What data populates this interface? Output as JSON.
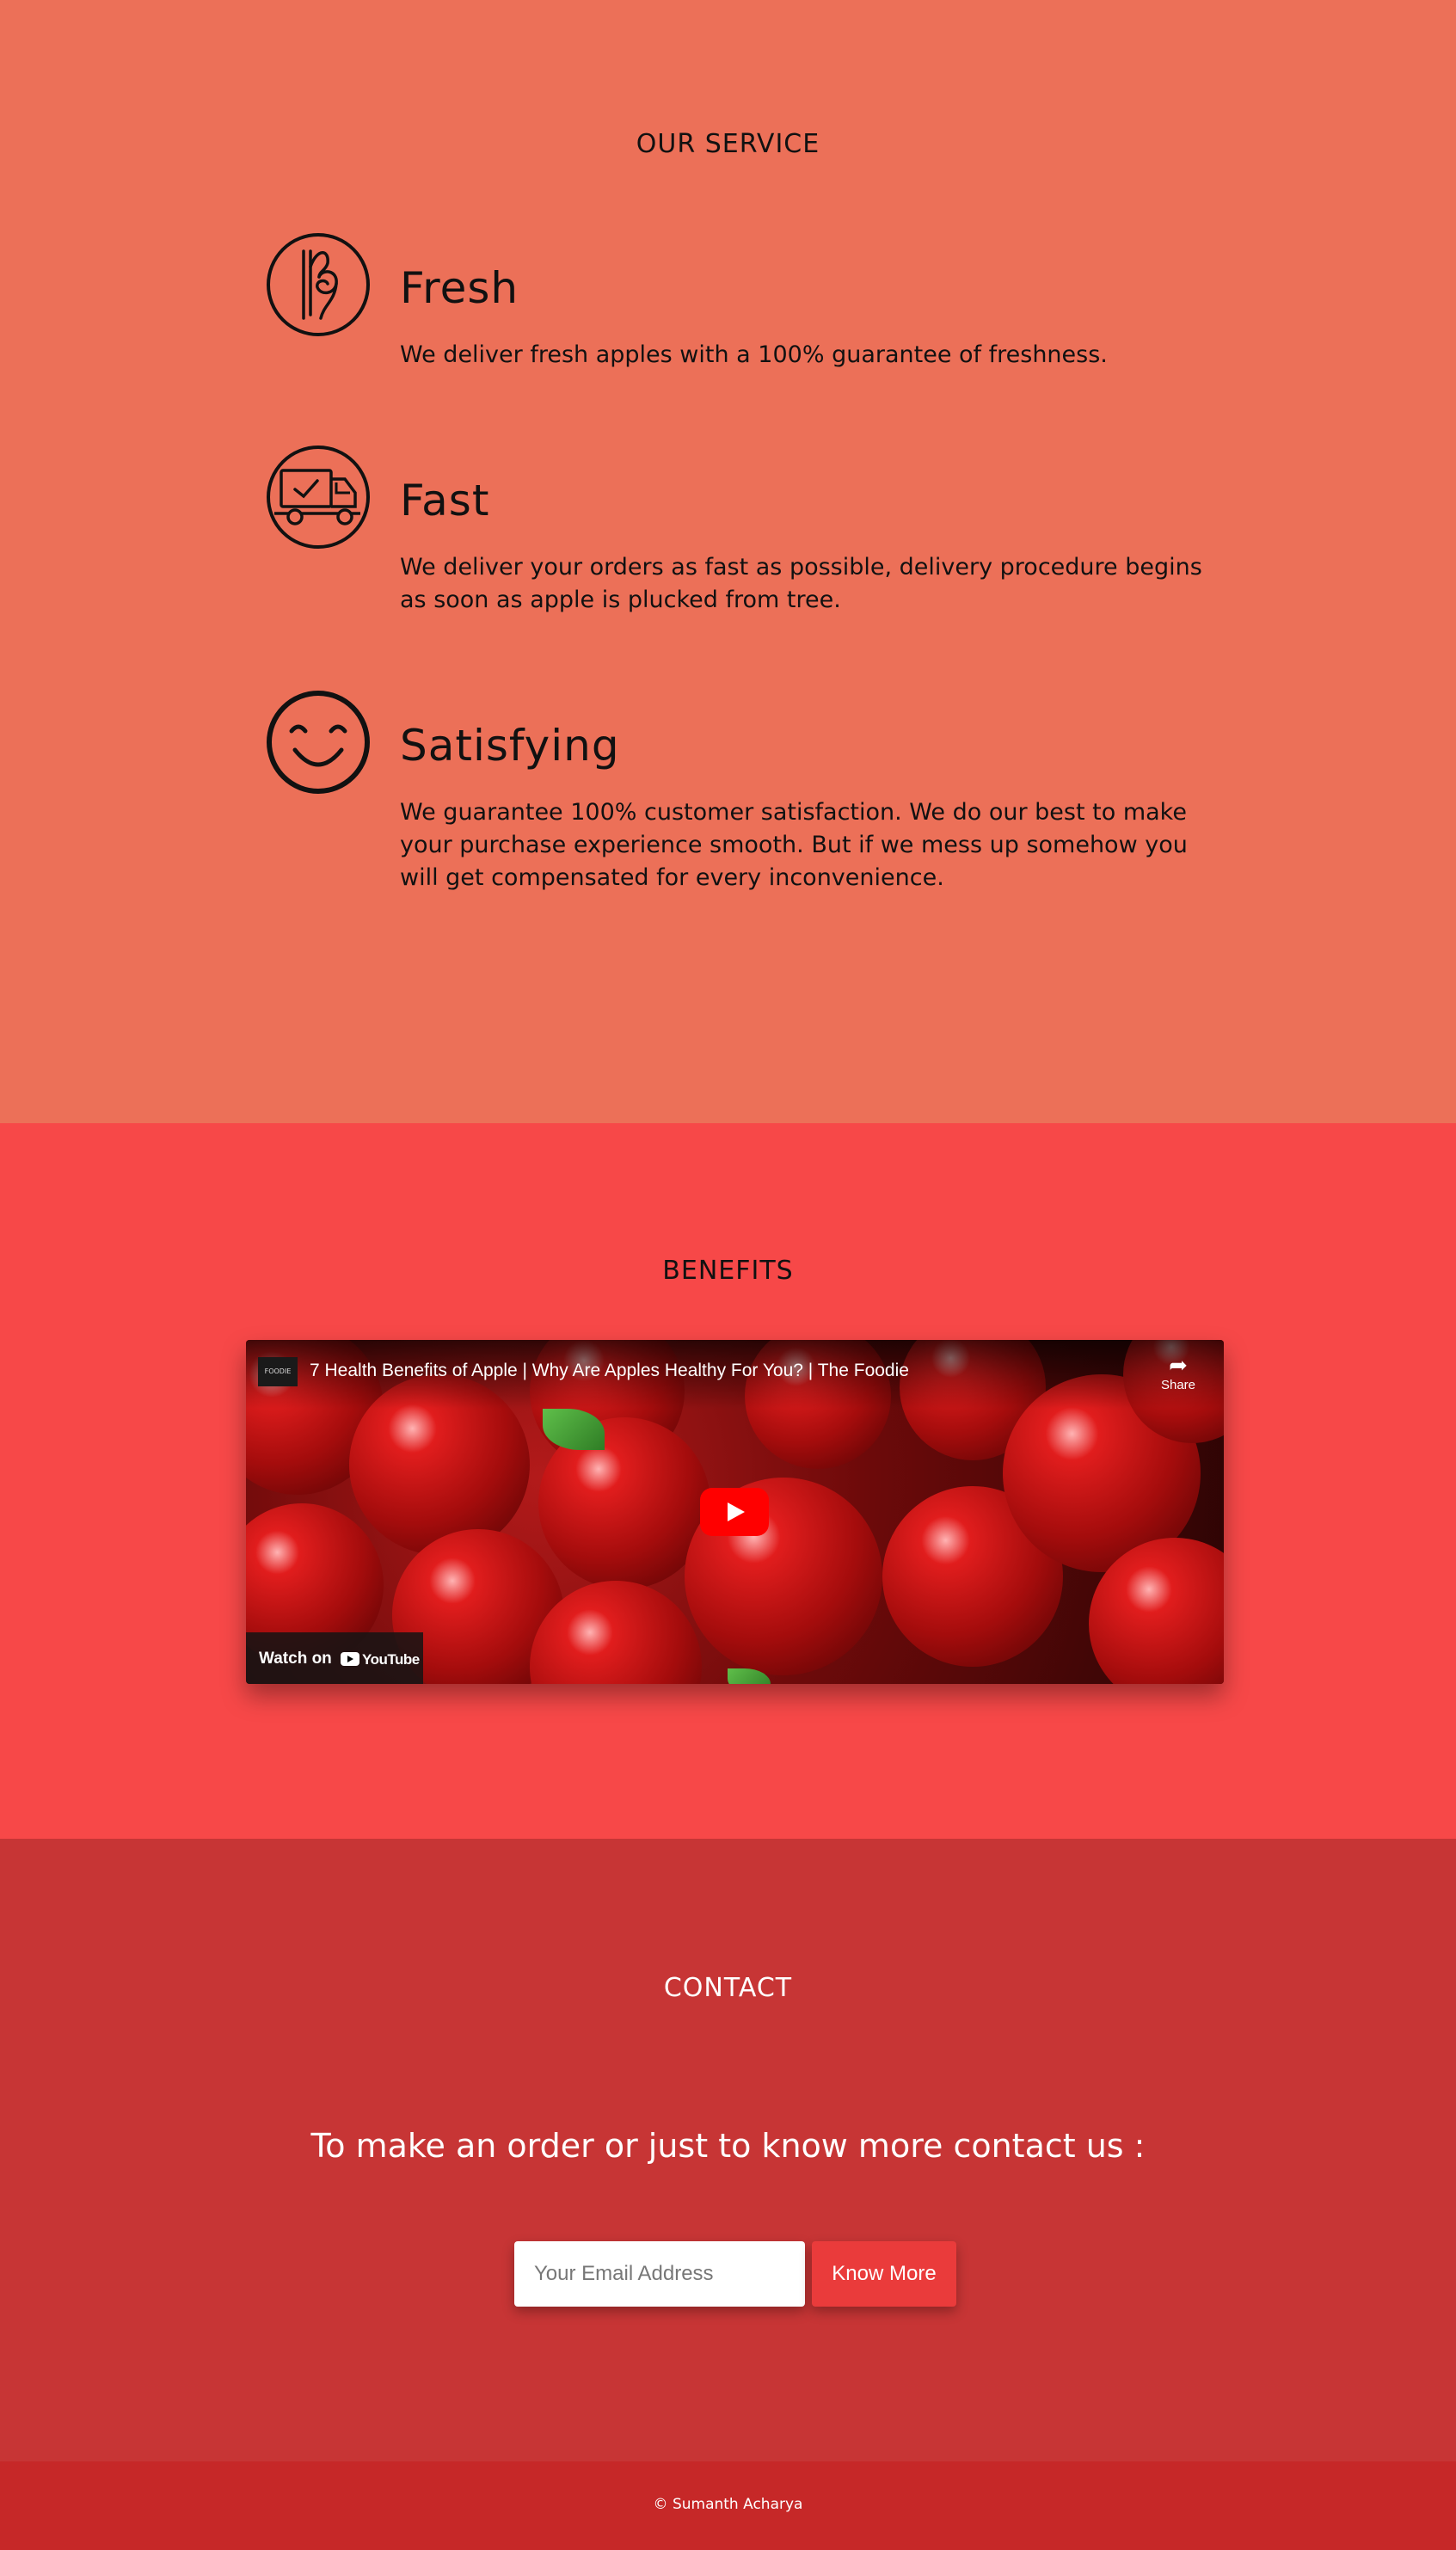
{
  "service": {
    "title": "OUR SERVICE",
    "features": [
      {
        "icon": "ok-hand-icon",
        "heading": "Fresh",
        "text": "We deliver fresh apples with a 100% guarantee of freshness."
      },
      {
        "icon": "delivery-truck-icon",
        "heading": "Fast",
        "text": "We deliver your orders as fast as possible, delivery procedure begins as soon as apple is plucked from tree."
      },
      {
        "icon": "smiley-face-icon",
        "heading": "Satisfying",
        "text": "We guarantee 100% customer satisfaction. We do our best to make your purchase experience smooth. But if we mess up somehow you will get compensated for every inconvenience."
      }
    ]
  },
  "benefits": {
    "title": "BENEFITS",
    "video": {
      "channel": "FOODIE",
      "title": "7 Health Benefits of Apple | Why Are Apples Healthy For You? | The Foodie",
      "share_label": "Share",
      "watch_on_label": "Watch on",
      "platform_label": "YouTube"
    }
  },
  "contact": {
    "title": "CONTACT",
    "text": "To make an order or just to know more contact us :",
    "email_placeholder": "Your Email Address",
    "button_label": "Know More"
  },
  "footer": {
    "copyright": "© Sumanth Acharya"
  },
  "colors": {
    "service_bg": "#ec7058",
    "benefits_bg": "#f74848",
    "contact_bg": "#c73535",
    "footer_bg": "#c62828",
    "button_bg": "#ea3b3b"
  }
}
